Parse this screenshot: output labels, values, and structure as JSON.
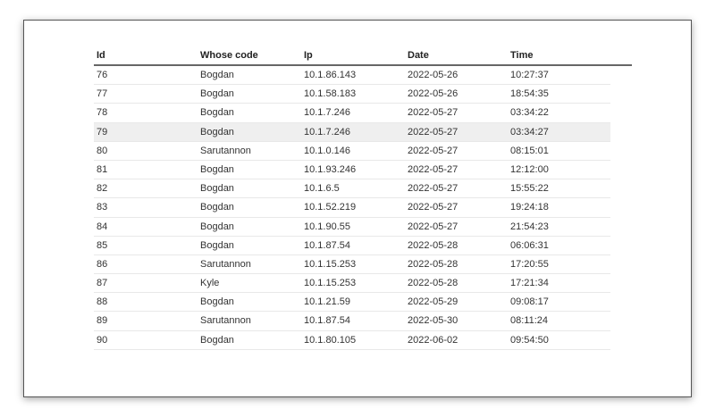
{
  "table": {
    "headers": [
      "Id",
      "Whose code",
      "Ip",
      "Date",
      "Time"
    ],
    "highlighted_row_id": "79",
    "rows": [
      [
        "76",
        "Bogdan",
        "10.1.86.143",
        "2022-05-26",
        "10:27:37"
      ],
      [
        "77",
        "Bogdan",
        "10.1.58.183",
        "2022-05-26",
        "18:54:35"
      ],
      [
        "78",
        "Bogdan",
        "10.1.7.246",
        "2022-05-27",
        "03:34:22"
      ],
      [
        "79",
        "Bogdan",
        "10.1.7.246",
        "2022-05-27",
        "03:34:27"
      ],
      [
        "80",
        "Sarutannon",
        "10.1.0.146",
        "2022-05-27",
        "08:15:01"
      ],
      [
        "81",
        "Bogdan",
        "10.1.93.246",
        "2022-05-27",
        "12:12:00"
      ],
      [
        "82",
        "Bogdan",
        "10.1.6.5",
        "2022-05-27",
        "15:55:22"
      ],
      [
        "83",
        "Bogdan",
        "10.1.52.219",
        "2022-05-27",
        "19:24:18"
      ],
      [
        "84",
        "Bogdan",
        "10.1.90.55",
        "2022-05-27",
        "21:54:23"
      ],
      [
        "85",
        "Bogdan",
        "10.1.87.54",
        "2022-05-28",
        "06:06:31"
      ],
      [
        "86",
        "Sarutannon",
        "10.1.15.253",
        "2022-05-28",
        "17:20:55"
      ],
      [
        "87",
        "Kyle",
        "10.1.15.253",
        "2022-05-28",
        "17:21:34"
      ],
      [
        "88",
        "Bogdan",
        "10.1.21.59",
        "2022-05-29",
        "09:08:17"
      ],
      [
        "89",
        "Sarutannon",
        "10.1.87.54",
        "2022-05-30",
        "08:11:24"
      ],
      [
        "90",
        "Bogdan",
        "10.1.80.105",
        "2022-06-02",
        "09:54:50"
      ]
    ]
  }
}
